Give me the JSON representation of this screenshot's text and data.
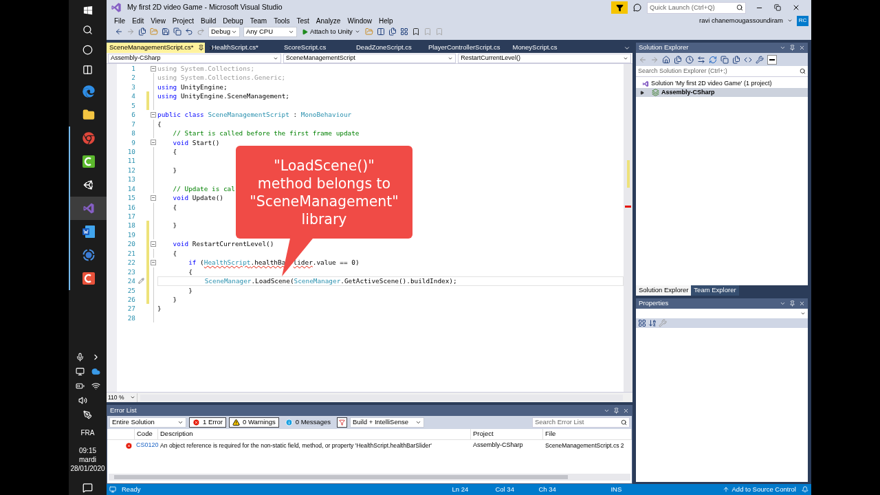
{
  "window": {
    "title": "My first 2D video Game - Microsoft Visual Studio"
  },
  "quick_launch": {
    "placeholder": "Quick Launch (Ctrl+Q)"
  },
  "menu": [
    "File",
    "Edit",
    "View",
    "Project",
    "Build",
    "Debug",
    "Team",
    "Tools",
    "Test",
    "Analyze",
    "Window",
    "Help"
  ],
  "account": {
    "name": "ravi chanemougassoundiram",
    "initials": "RC"
  },
  "toolbar": {
    "configuration": "Debug",
    "platform": "Any CPU",
    "run_button": "Attach to Unity"
  },
  "editor": {
    "tabs": [
      {
        "label": "SceneManagementScript.cs*",
        "selected": true
      },
      {
        "label": "HealthScript.cs*",
        "selected": false
      },
      {
        "label": "ScoreScript.cs",
        "selected": false
      },
      {
        "label": "DeadZoneScript.cs",
        "selected": false
      },
      {
        "label": "PlayerControllerScript.cs",
        "selected": false
      },
      {
        "label": "MoneyScript.cs",
        "selected": false
      }
    ],
    "navigation": [
      "Assembly-CSharp",
      "SceneManagementScript",
      "RestartCurrentLevel()"
    ],
    "lines": [
      {
        "number": "1",
        "changed": false,
        "fold": true,
        "current": false,
        "tokens": [
          {
            "text": "using System.Collections;",
            "kind": "unused"
          }
        ]
      },
      {
        "number": "2",
        "changed": false,
        "fold": false,
        "current": false,
        "tokens": [
          {
            "text": "using System.Collections.Generic;",
            "kind": "unused"
          }
        ]
      },
      {
        "number": "3",
        "changed": false,
        "fold": false,
        "current": false,
        "tokens": [
          {
            "text": "using",
            "kind": "keyword"
          },
          {
            "text": " UnityEngine;",
            "kind": "plain"
          }
        ]
      },
      {
        "number": "4",
        "changed": true,
        "fold": false,
        "current": false,
        "tokens": [
          {
            "text": "using",
            "kind": "keyword"
          },
          {
            "text": " UnityEngine.SceneManagement;",
            "kind": "plain"
          }
        ]
      },
      {
        "number": "5",
        "changed": true,
        "fold": false,
        "current": false
      },
      {
        "number": "6",
        "changed": false,
        "fold": true,
        "current": false,
        "tokens": [
          {
            "text": "public class ",
            "kind": "keyword"
          },
          {
            "text": "SceneManagementScript",
            "kind": "type"
          },
          {
            "text": " : ",
            "kind": "plain"
          },
          {
            "text": "MonoBehaviour",
            "kind": "type"
          }
        ]
      },
      {
        "number": "7",
        "changed": false,
        "fold": false,
        "current": false,
        "tokens": [
          {
            "text": "{",
            "kind": "plain"
          }
        ]
      },
      {
        "number": "8",
        "changed": false,
        "fold": false,
        "current": false,
        "tokens": [
          {
            "text": "    // Start is called before the first frame update",
            "kind": "comment"
          }
        ]
      },
      {
        "number": "9",
        "changed": false,
        "fold": true,
        "current": false,
        "tokens": [
          {
            "text": "    void ",
            "kind": "keyword"
          },
          {
            "text": "Start()",
            "kind": "plain"
          }
        ]
      },
      {
        "number": "10",
        "changed": false,
        "fold": false,
        "current": false,
        "tokens": [
          {
            "text": "    {",
            "kind": "plain"
          }
        ]
      },
      {
        "number": "11",
        "changed": false,
        "fold": false,
        "current": false
      },
      {
        "number": "12",
        "changed": false,
        "fold": false,
        "current": false,
        "tokens": [
          {
            "text": "    }",
            "kind": "plain"
          }
        ]
      },
      {
        "number": "13",
        "changed": false,
        "fold": false,
        "current": false
      },
      {
        "number": "14",
        "changed": false,
        "fold": false,
        "current": false,
        "tokens": [
          {
            "text": "    // Update is cal",
            "kind": "comment"
          }
        ]
      },
      {
        "number": "15",
        "changed": false,
        "fold": true,
        "current": false,
        "tokens": [
          {
            "text": "    void ",
            "kind": "keyword"
          },
          {
            "text": "Update()",
            "kind": "plain"
          }
        ]
      },
      {
        "number": "16",
        "changed": false,
        "fold": false,
        "current": false,
        "tokens": [
          {
            "text": "    {",
            "kind": "plain"
          }
        ]
      },
      {
        "number": "17",
        "changed": false,
        "fold": false,
        "current": false
      },
      {
        "number": "18",
        "changed": true,
        "fold": false,
        "current": false,
        "tokens": [
          {
            "text": "    }",
            "kind": "plain"
          }
        ]
      },
      {
        "number": "19",
        "changed": true,
        "fold": false,
        "current": false
      },
      {
        "number": "20",
        "changed": true,
        "fold": true,
        "current": false,
        "tokens": [
          {
            "text": "    void ",
            "kind": "keyword"
          },
          {
            "text": "RestartCurrentLevel()",
            "kind": "plain"
          }
        ]
      },
      {
        "number": "21",
        "changed": true,
        "fold": false,
        "current": false,
        "tokens": [
          {
            "text": "    {",
            "kind": "plain"
          }
        ]
      },
      {
        "number": "22",
        "changed": true,
        "fold": true,
        "current": false,
        "tokens": [
          {
            "text": "        if ",
            "kind": "keyword"
          },
          {
            "text": "(",
            "kind": "plain"
          },
          {
            "text": "HealthScript",
            "kind": "type_error"
          },
          {
            "text": ".healthBa",
            "kind": "plain_error"
          },
          {
            "text": "lider",
            "kind": "plain_error",
            "covered_before": true
          },
          {
            "text": ".value == 0)",
            "kind": "plain"
          }
        ]
      },
      {
        "number": "23",
        "changed": true,
        "fold": false,
        "current": false,
        "tokens": [
          {
            "text": "        {",
            "kind": "plain"
          }
        ]
      },
      {
        "number": "24",
        "changed": true,
        "fold": false,
        "current": true,
        "tokens": [
          {
            "text": "            SceneManager",
            "kind": "type"
          },
          {
            "text": ".LoadScene(",
            "kind": "plain"
          },
          {
            "text": "SceneManager",
            "kind": "type"
          },
          {
            "text": ".GetActiveScene().buildIndex);",
            "kind": "plain"
          }
        ]
      },
      {
        "number": "25",
        "changed": true,
        "fold": false,
        "current": false,
        "tokens": [
          {
            "text": "        }",
            "kind": "plain"
          }
        ]
      },
      {
        "number": "26",
        "changed": true,
        "fold": false,
        "current": false,
        "tokens": [
          {
            "text": "    }",
            "kind": "plain"
          }
        ]
      },
      {
        "number": "27",
        "changed": false,
        "fold": false,
        "current": false,
        "tokens": [
          {
            "text": "}",
            "kind": "plain"
          }
        ]
      },
      {
        "number": "28",
        "changed": false,
        "fold": false,
        "current": false
      }
    ],
    "zoom": "110 %",
    "callout": {
      "lines": [
        "\"LoadScene()\"",
        "method belongs to",
        "\"SceneManagement\"",
        "library"
      ]
    }
  },
  "error_list": {
    "title": "Error List",
    "scope": "Entire Solution",
    "filters": [
      {
        "label": "1 Error",
        "kind": "error",
        "selected": true
      },
      {
        "label": "0 Warnings",
        "kind": "warning",
        "selected": true
      },
      {
        "label": "0 Messages",
        "kind": "message",
        "selected": false
      }
    ],
    "source": "Build + IntelliSense",
    "search": {
      "placeholder": "Search Error List"
    },
    "columns": [
      "Code",
      "Description",
      "Project",
      "File"
    ],
    "rows": [
      {
        "code": "CS0120",
        "description": "An object reference is required for the non-static field, method, or property 'HealthScript.healthBarSlider'",
        "project": "Assembly-CSharp",
        "file": "SceneManagementScript.cs 2"
      }
    ]
  },
  "solution_explorer": {
    "title": "Solution Explorer",
    "search": {
      "placeholder": "Search Solution Explorer (Ctrl+;)"
    },
    "tree": [
      {
        "label": "Solution 'My first 2D video Game' (1 project)",
        "selected": false,
        "children": [
          {
            "label": "Assembly-CSharp",
            "selected": true,
            "expanded": false
          }
        ]
      }
    ],
    "tabs": [
      {
        "label": "Solution Explorer",
        "selected": true
      },
      {
        "label": "Team Explorer",
        "selected": false
      }
    ]
  },
  "properties": {
    "title": "Properties"
  },
  "status_bar": {
    "status": "Ready",
    "line": "Ln 24",
    "column": "Col 34",
    "char": "Ch 34",
    "mode": "INS",
    "source_control": "Add to Source Control"
  },
  "taskbar": {
    "apps": [
      {
        "selected": false,
        "running": false
      },
      {
        "selected": false,
        "running": false
      },
      {
        "selected": false,
        "running": true
      },
      {
        "selected": false,
        "running": true
      },
      {
        "selected": false,
        "running": true
      },
      {
        "selected": true,
        "running": true
      },
      {
        "selected": false,
        "running": true
      },
      {
        "selected": false,
        "running": true
      },
      {
        "selected": false,
        "running": true
      }
    ],
    "language": "FRA",
    "time": "09:15",
    "day": "mardi",
    "date": "28/01/2020"
  }
}
